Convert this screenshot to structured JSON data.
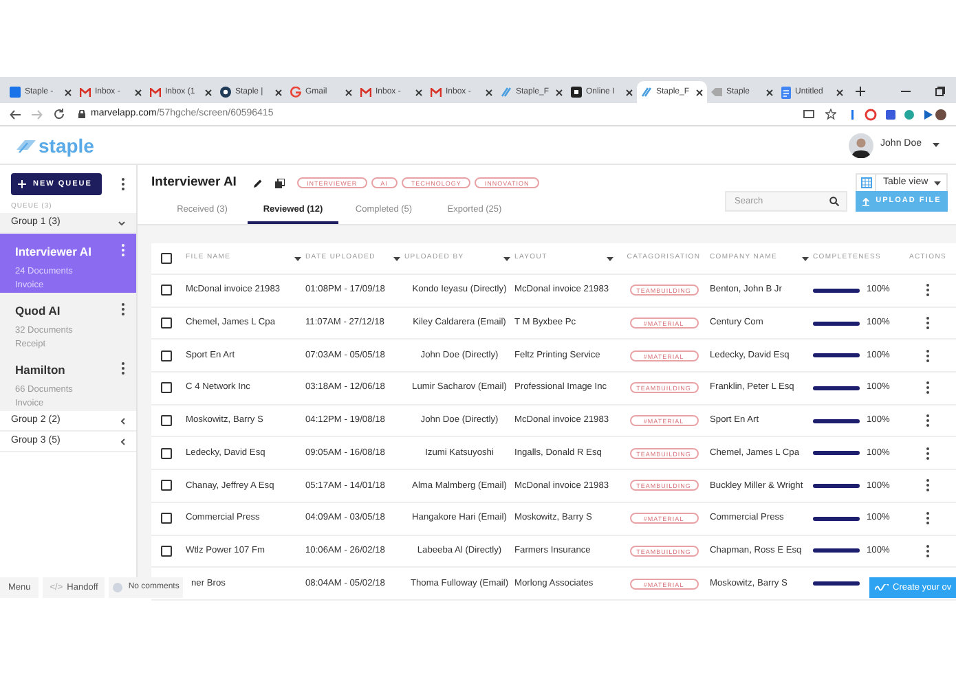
{
  "browser": {
    "tabs": [
      {
        "title": "Staple -",
        "kind": "calendar",
        "selected": false
      },
      {
        "title": "Inbox -",
        "kind": "mail",
        "selected": false
      },
      {
        "title": "Inbox (1",
        "kind": "mail",
        "selected": false
      },
      {
        "title": "Staple |",
        "kind": "circle",
        "selected": false
      },
      {
        "title": "Gmail",
        "kind": "google",
        "selected": false
      },
      {
        "title": "Inbox -",
        "kind": "mail",
        "selected": false
      },
      {
        "title": "Inbox -",
        "kind": "mail",
        "selected": false
      },
      {
        "title": "Staple_F",
        "kind": "staple",
        "selected": false
      },
      {
        "title": "Online I",
        "kind": "dark",
        "selected": false
      },
      {
        "title": "Staple_F",
        "kind": "staple",
        "selected": true
      },
      {
        "title": "Staple",
        "kind": "blank",
        "selected": false
      },
      {
        "title": "Untitled",
        "kind": "docs",
        "selected": false
      }
    ],
    "url_host": "marvelapp.com",
    "url_path": "/57hgche/screen/60596415"
  },
  "header": {
    "logo": "staple",
    "user": "John Doe"
  },
  "sidebar": {
    "new_queue": "NEW QUEUE",
    "queue_label": "QUEUE (3)",
    "groups": [
      {
        "label": "Group 1 (3)",
        "expanded": true,
        "items": [
          {
            "name": "Interviewer AI",
            "count": "24 Documents",
            "type": "Invoice",
            "selected": true
          },
          {
            "name": "Quod AI",
            "count": "32 Documents",
            "type": "Receipt",
            "selected": false
          },
          {
            "name": "Hamilton",
            "count": "66 Documents",
            "type": "Invoice",
            "selected": false
          }
        ]
      },
      {
        "label": "Group 2 (2)",
        "expanded": false
      },
      {
        "label": "Group 3 (5)",
        "expanded": false
      }
    ]
  },
  "queue": {
    "title": "Interviewer AI",
    "tags": [
      "INTERVIEWER",
      "AI",
      "TECHNOLOGY",
      "INNOVATION"
    ],
    "tabs": [
      {
        "label": "Received (3)",
        "selected": false
      },
      {
        "label": "Reviewed (12)",
        "selected": true
      },
      {
        "label": "Completed (5)",
        "selected": false
      },
      {
        "label": "Exported (25)",
        "selected": false
      }
    ],
    "view": "Table view",
    "search": {
      "placeholder": "Search"
    },
    "upload": "UPLOAD FILE"
  },
  "table": {
    "select_all_checked": false,
    "columns": [
      {
        "label": "FILE NAME",
        "sortable": true
      },
      {
        "label": "DATE UPLOADED",
        "sortable": true
      },
      {
        "label": "UPLOADED BY",
        "sortable": true
      },
      {
        "label": "LAYOUT",
        "sortable": true
      },
      {
        "label": "CATAGORISATION",
        "sortable": false
      },
      {
        "label": "COMPANY NAME",
        "sortable": true
      },
      {
        "label": "COMPLETENESS",
        "sortable": false
      },
      {
        "label": "ACTIONS",
        "sortable": false
      }
    ],
    "rows": [
      {
        "checked": false,
        "file": "McDonal invoice 21983",
        "date": "01:08PM - 17/09/18",
        "by": "Kondo Ieyasu (Directly)",
        "layout": "McDonal invoice 21983",
        "tag": "TEAMBUILDING",
        "company": "Benton, John B Jr",
        "level": 1,
        "percent": "100%"
      },
      {
        "checked": false,
        "file": "Chemel, James L Cpa",
        "date": "11:07AM - 27/12/18",
        "by": "Kiley Caldarera (Email)",
        "layout": "T M Byxbee  Pc",
        "tag": "#MATERIAL",
        "company": "Century Com",
        "level": 1,
        "percent": "100%"
      },
      {
        "checked": false,
        "file": "Sport En Art",
        "date": "07:03AM - 05/05/18",
        "by": "John Doe  (Directly)",
        "layout": "Feltz Printing Service",
        "tag": "#MATERIAL",
        "company": "Ledecky, David Esq",
        "level": 1,
        "percent": "100%"
      },
      {
        "checked": false,
        "file": "C 4 Network Inc",
        "date": "03:18AM - 12/06/18",
        "by": "Lumir Sacharov (Email)",
        "layout": "Professional Image Inc",
        "tag": "TEAMBUILDING",
        "company": "Franklin, Peter L Esq",
        "level": 1,
        "percent": "100%"
      },
      {
        "checked": false,
        "file": "Moskowitz, Barry S",
        "date": "04:12PM - 19/08/18",
        "by": "John Doe (Directly)",
        "layout": "McDonal invoice 21983",
        "tag": "#MATERIAL",
        "company": "Sport En Art",
        "level": 1,
        "percent": "100%"
      },
      {
        "checked": false,
        "file": "Ledecky, David Esq",
        "date": "09:05AM - 16/08/18",
        "by": "Izumi Katsuyoshi",
        "layout": "Ingalls, Donald R Esq",
        "tag": "TEAMBUILDING",
        "company": "Chemel, James L Cpa",
        "level": 1,
        "percent": "100%"
      },
      {
        "checked": false,
        "file": "Chanay, Jeffrey A Esq",
        "date": "05:17AM - 14/01/18",
        "by": "Alma Malmberg (Email)",
        "layout": "McDonal invoice 21983",
        "tag": "TEAMBUILDING",
        "company": "Buckley Miller & Wright",
        "level": 1,
        "percent": "100%"
      },
      {
        "checked": false,
        "file": "Commercial Press",
        "date": "04:09AM - 03/05/18",
        "by": "Hangakore Hari (Email)",
        "layout": "Moskowitz, Barry S",
        "tag": "#MATERIAL",
        "company": "Commercial Press",
        "level": 1,
        "percent": "100%"
      },
      {
        "checked": false,
        "file": "Wtlz Power 107 Fm",
        "date": "10:06AM - 26/02/18",
        "by": "Labeeba Al (Directly)",
        "layout": "Farmers Insurance",
        "tag": "TEAMBUILDING",
        "company": "Chapman, Ross E Esq",
        "level": 1,
        "percent": "100%"
      },
      {
        "file": "ner Bros",
        "date": "08:04AM - 05/02/18",
        "by": "Thoma Fulloway (Email)",
        "layout": "Morlong Associates",
        "tag": "#MATERIAL",
        "company": "Moskowitz, Barry S",
        "level": 1
      }
    ]
  },
  "marvel": {
    "menu": "Menu",
    "handoff_icon": "</>",
    "handoff": "Handoff",
    "comments": "No comments",
    "create": "Create your ov"
  }
}
